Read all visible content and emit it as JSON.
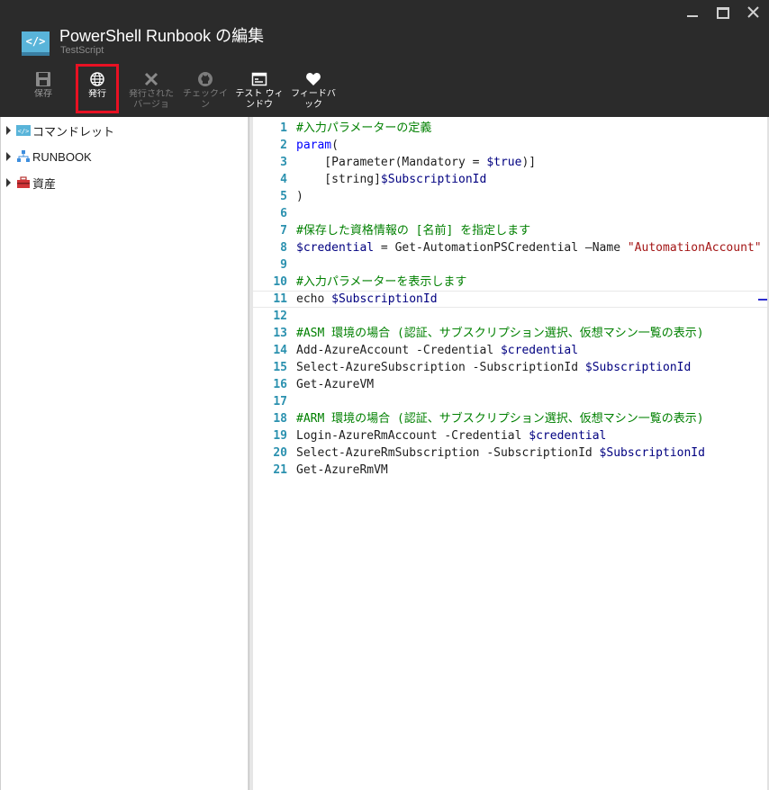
{
  "window": {
    "title": "PowerShell Runbook の編集",
    "subtitle": "TestScript",
    "app_icon_text": "</>"
  },
  "toolbar": {
    "save_label": "保存",
    "publish_label": "発行",
    "revert_label": "発行されたバージョン…",
    "checkin_label": "チェックイン",
    "testpane_label": "テスト ウィンドウ",
    "feedback_label": "フィードバック"
  },
  "tree": {
    "items": [
      {
        "label": "コマンドレット",
        "icon": "cmdlet-icon"
      },
      {
        "label": "RUNBOOK",
        "icon": "runbook-icon"
      },
      {
        "label": "資産",
        "icon": "assets-icon"
      }
    ]
  },
  "editor": {
    "line_numbers": [
      "1",
      "2",
      "3",
      "4",
      "5",
      "6",
      "7",
      "8",
      "9",
      "10",
      "11",
      "12",
      "13",
      "14",
      "15",
      "16",
      "17",
      "18",
      "19",
      "20",
      "21"
    ],
    "lines": [
      {
        "segments": [
          {
            "t": "cm",
            "v": "#入力パラメーターの定義"
          }
        ]
      },
      {
        "segments": [
          {
            "t": "kw",
            "v": "param"
          },
          {
            "t": "plain",
            "v": "("
          }
        ]
      },
      {
        "segments": [
          {
            "t": "plain",
            "v": "    [Parameter(Mandatory = "
          },
          {
            "t": "var",
            "v": "$true"
          },
          {
            "t": "plain",
            "v": ")]"
          }
        ]
      },
      {
        "segments": [
          {
            "t": "plain",
            "v": "    [string]"
          },
          {
            "t": "var",
            "v": "$SubscriptionId"
          }
        ]
      },
      {
        "segments": [
          {
            "t": "plain",
            "v": ")"
          }
        ]
      },
      {
        "segments": []
      },
      {
        "segments": [
          {
            "t": "cm",
            "v": "#保存した資格情報の [名前] を指定します"
          }
        ]
      },
      {
        "segments": [
          {
            "t": "var",
            "v": "$credential"
          },
          {
            "t": "plain",
            "v": " = Get-AutomationPSCredential –Name "
          },
          {
            "t": "str",
            "v": "\"AutomationAccount\""
          }
        ]
      },
      {
        "segments": []
      },
      {
        "segments": [
          {
            "t": "cm",
            "v": "#入力パラメーターを表示します"
          }
        ]
      },
      {
        "segments": [
          {
            "t": "plain",
            "v": "echo "
          },
          {
            "t": "var",
            "v": "$SubscriptionId"
          }
        ]
      },
      {
        "segments": []
      },
      {
        "segments": [
          {
            "t": "cm",
            "v": "#ASM 環境の場合 (認証、サブスクリプション選択、仮想マシン一覧の表示)"
          }
        ]
      },
      {
        "segments": [
          {
            "t": "plain",
            "v": "Add-AzureAccount -Credential "
          },
          {
            "t": "var",
            "v": "$credential"
          }
        ]
      },
      {
        "segments": [
          {
            "t": "plain",
            "v": "Select-AzureSubscription -SubscriptionId "
          },
          {
            "t": "var",
            "v": "$SubscriptionId"
          }
        ]
      },
      {
        "segments": [
          {
            "t": "plain",
            "v": "Get-AzureVM"
          }
        ]
      },
      {
        "segments": []
      },
      {
        "segments": [
          {
            "t": "cm",
            "v": "#ARM 環境の場合 (認証、サブスクリプション選択、仮想マシン一覧の表示)"
          }
        ]
      },
      {
        "segments": [
          {
            "t": "plain",
            "v": "Login-AzureRmAccount -Credential "
          },
          {
            "t": "var",
            "v": "$credential"
          }
        ]
      },
      {
        "segments": [
          {
            "t": "plain",
            "v": "Select-AzureRmSubscription -SubscriptionId "
          },
          {
            "t": "var",
            "v": "$SubscriptionId"
          }
        ]
      },
      {
        "segments": [
          {
            "t": "plain",
            "v": "Get-AzureRmVM"
          }
        ]
      }
    ],
    "current_line_index": 10
  },
  "colors": {
    "header_bg": "#2b2b2b",
    "highlight": "#e81123",
    "comment": "#008000",
    "keyword": "#0000ff",
    "variable": "#000080",
    "string": "#a31515",
    "line_number": "#2b91af"
  }
}
